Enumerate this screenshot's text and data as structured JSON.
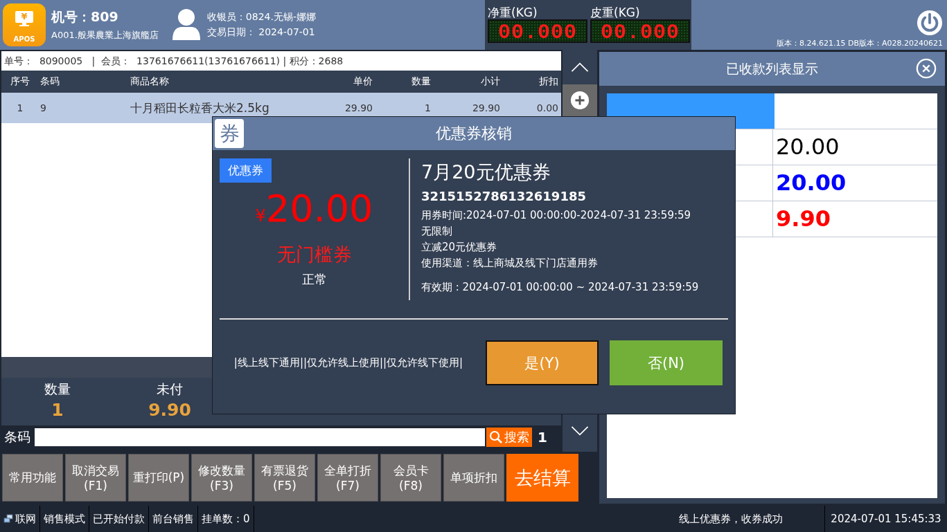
{
  "header": {
    "logo": {
      "symbol": "¥",
      "label": "APOS"
    },
    "terminal": "机号：809",
    "store": "A001.般果農業上海旗艦店",
    "cashier": "收银员：0824.无锡-娜娜",
    "trade_date": "交易日期： 2024-07-01",
    "scales": [
      {
        "label": "净重(KG)",
        "reading": "00.000"
      },
      {
        "label": "皮重(KG)",
        "reading": "00.000"
      }
    ],
    "version": "版本：8.24.621.15 DB版本：A028.20240621"
  },
  "order_info": "单号：  8090005   |  会员：  13761676611(13761676611) | 积分：2688",
  "table": {
    "columns": [
      "序号",
      "条码",
      "商品名称",
      "单价",
      "数量",
      "小计",
      "折扣"
    ],
    "rows": [
      {
        "cells": [
          "1",
          "9",
          "十月稻田长粒香大米2.5kg",
          "29.90",
          "1",
          "29.90",
          "0.00"
        ],
        "selected": true
      }
    ]
  },
  "summary": [
    {
      "label": "数量",
      "value": "1"
    },
    {
      "label": "未付",
      "value": "9.90"
    }
  ],
  "barcode": {
    "label": "条码",
    "search": "搜索",
    "count": "1"
  },
  "functions": [
    {
      "label": "常用功能"
    },
    {
      "label": "取消交易",
      "key": "(F1)"
    },
    {
      "label": "重打印(P)"
    },
    {
      "label": "修改数量",
      "key": "(F3)"
    },
    {
      "label": "有票退货",
      "key": "(F5)"
    },
    {
      "label": "全单打折",
      "key": "(F7)"
    },
    {
      "label": "会员卡",
      "key": "(F8)"
    },
    {
      "label": "单项折扣"
    }
  ],
  "checkout": "去结算",
  "payments_panel": {
    "title": "已收款列表显示",
    "rows": [
      {
        "amount": "20.00",
        "color": "#000000",
        "emphasis": false
      },
      {
        "amount": "20.00",
        "color": "#0000ff",
        "emphasis": true
      },
      {
        "amount": "9.90",
        "color": "#ff0000",
        "emphasis": true
      }
    ]
  },
  "dialog": {
    "icon_text": "券",
    "title": "优惠券核销",
    "tag": "优惠券",
    "currency": "¥",
    "amount": "20.00",
    "type": "无门槛券",
    "status": "正常",
    "name": "7月20元优惠券",
    "code": "3215152786132619185",
    "details": [
      "用券时间:2024-07-01 00:00:00-2024-07-31 23:59:59",
      "无限制",
      "立减20元优惠券",
      "使用渠道：线上商城及线下门店通用券"
    ],
    "validity": "有效期 : 2024-07-01 00:00:00 ~ 2024-07-31 23:59:59",
    "channels": "|线上线下通用||仅允许线上使用||仅允许线下使用|",
    "buttons": [
      {
        "label": "是(Y)",
        "kind": "confirm"
      },
      {
        "label": "否(N)",
        "kind": "cancel"
      }
    ]
  },
  "status_bar": {
    "items": [
      {
        "label": "联网",
        "kind": "network"
      },
      {
        "label": "销售模式"
      },
      {
        "label": "已开始付款"
      },
      {
        "label": "前台销售"
      },
      {
        "label": "挂单数：0"
      }
    ],
    "message": "线上优惠券，收券成功",
    "time": "2024-07-01 15:45:33"
  }
}
